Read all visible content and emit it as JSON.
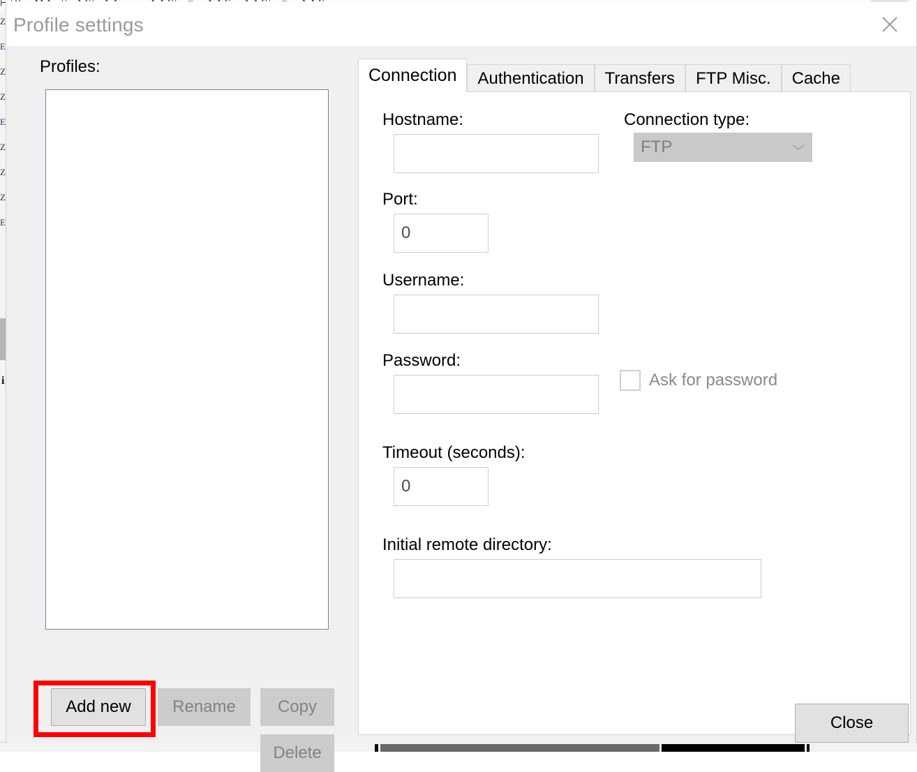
{
  "background": {
    "toolbar_text": "⊢|∨ ⌐MΛ⌐||⌐ΛΓ|⌐ΛΛ ⌐χ ⌐ΛΛΓ|m≡ ⌐ΛΛΓ ⌐ΛΛΓ|m≡ ⌐ΛΛΓ",
    "left_strip_text": "Z E Z Z E Z Z Z E",
    "left_strip_marker": "i"
  },
  "window": {
    "title": "Profile settings",
    "close_icon": "close-x-icon"
  },
  "profiles_panel": {
    "label": "Profiles:",
    "items": [],
    "buttons": {
      "add_new": {
        "label": "Add new",
        "enabled": true,
        "highlighted": true
      },
      "rename": {
        "label": "Rename",
        "enabled": false
      },
      "copy": {
        "label": "Copy",
        "enabled": false
      },
      "delete": {
        "label": "Delete",
        "enabled": false
      }
    }
  },
  "tabs": {
    "active_index": 0,
    "items": [
      {
        "label": "Connection"
      },
      {
        "label": "Authentication"
      },
      {
        "label": "Transfers"
      },
      {
        "label": "FTP Misc."
      },
      {
        "label": "Cache"
      }
    ]
  },
  "connection_tab": {
    "hostname": {
      "label": "Hostname:",
      "value": "",
      "placeholder": ""
    },
    "connection_type": {
      "label": "Connection type:",
      "selected": "FTP",
      "enabled": false,
      "arrow_icon": "chevron-down-icon"
    },
    "port": {
      "label": "Port:",
      "value": "0"
    },
    "username": {
      "label": "Username:",
      "value": "",
      "placeholder": ""
    },
    "password": {
      "label": "Password:",
      "value": "",
      "placeholder": ""
    },
    "ask_for_password": {
      "label": "Ask for password",
      "checked": false,
      "enabled": false
    },
    "timeout": {
      "label": "Timeout (seconds):",
      "value": "0"
    },
    "initial_remote_directory": {
      "label": "Initial remote directory:",
      "value": "",
      "placeholder": ""
    }
  },
  "footer": {
    "close_button": "Close"
  },
  "colors": {
    "dialog_bg": "#f0f0f0",
    "titlebar_bg": "#ffffff",
    "title_text": "#9a9a9a",
    "panel_bg": "#ffffff",
    "input_border": "#cccccc",
    "list_border": "#7a828c",
    "button_enabled_bg": "#e1e1e1",
    "button_disabled_bg": "#cccccc",
    "button_disabled_text": "#838383",
    "disabled_select_bg": "#c9c9c9",
    "highlight_red": "#ff0000"
  }
}
